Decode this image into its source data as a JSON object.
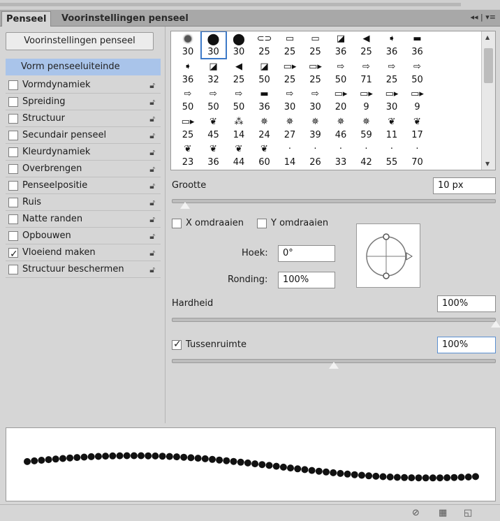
{
  "tabs": {
    "active": "Penseel",
    "inactive": "Voorinstellingen penseel",
    "menu": "◂◂ | ▾≡"
  },
  "left": {
    "preset_button": "Voorinstellingen penseel",
    "tip_label": "Vorm penseeluiteinde",
    "options": [
      {
        "label": "Vormdynamiek",
        "checked": false
      },
      {
        "label": "Spreiding",
        "checked": false
      },
      {
        "label": "Structuur",
        "checked": false
      },
      {
        "label": "Secundair penseel",
        "checked": false
      },
      {
        "label": "Kleurdynamiek",
        "checked": false
      },
      {
        "label": "Overbrengen",
        "checked": false
      },
      {
        "label": "Penseelpositie",
        "checked": false
      },
      {
        "label": "Ruis",
        "checked": false
      },
      {
        "label": "Natte randen",
        "checked": false
      },
      {
        "label": "Opbouwen",
        "checked": false
      },
      {
        "label": "Vloeiend maken",
        "checked": true
      },
      {
        "label": "Structuur beschermen",
        "checked": false
      }
    ]
  },
  "brushes": {
    "rows": [
      [
        {
          "icon": "soft-round",
          "size": "30"
        },
        {
          "icon": "hard-round",
          "size": "30",
          "selected": true
        },
        {
          "icon": "hard-round",
          "size": "30"
        },
        {
          "icon": "tip-a",
          "size": "25"
        },
        {
          "icon": "tip-b",
          "size": "25"
        },
        {
          "icon": "tip-b",
          "size": "25"
        },
        {
          "icon": "tip-c",
          "size": "36"
        },
        {
          "icon": "tip-d",
          "size": "25"
        },
        {
          "icon": "tip-e",
          "size": "36"
        },
        {
          "icon": "tip-f",
          "size": "36"
        }
      ],
      [
        {
          "icon": "tip-e",
          "size": "36"
        },
        {
          "icon": "tip-c",
          "size": "32"
        },
        {
          "icon": "tip-d",
          "size": "25"
        },
        {
          "icon": "tip-c",
          "size": "50"
        },
        {
          "icon": "tip-g",
          "size": "25"
        },
        {
          "icon": "tip-g",
          "size": "25"
        },
        {
          "icon": "tip-h",
          "size": "50"
        },
        {
          "icon": "tip-h",
          "size": "71"
        },
        {
          "icon": "tip-h",
          "size": "25"
        },
        {
          "icon": "tip-h",
          "size": "50"
        }
      ],
      [
        {
          "icon": "tip-h",
          "size": "50"
        },
        {
          "icon": "tip-h",
          "size": "50"
        },
        {
          "icon": "tip-h",
          "size": "50"
        },
        {
          "icon": "tip-f",
          "size": "36"
        },
        {
          "icon": "tip-h",
          "size": "30"
        },
        {
          "icon": "tip-h",
          "size": "30"
        },
        {
          "icon": "tip-g",
          "size": "20"
        },
        {
          "icon": "tip-g",
          "size": "9"
        },
        {
          "icon": "tip-g",
          "size": "30"
        },
        {
          "icon": "tip-g",
          "size": "9"
        }
      ],
      [
        {
          "icon": "tip-g",
          "size": "25"
        },
        {
          "icon": "leaf",
          "size": "45"
        },
        {
          "icon": "grass",
          "size": "14"
        },
        {
          "icon": "scatter",
          "size": "24"
        },
        {
          "icon": "scatter",
          "size": "27"
        },
        {
          "icon": "scatter",
          "size": "39"
        },
        {
          "icon": "scatter",
          "size": "46"
        },
        {
          "icon": "scatter",
          "size": "59"
        },
        {
          "icon": "leaf",
          "size": "11"
        },
        {
          "icon": "leaf",
          "size": "17"
        }
      ],
      [
        {
          "icon": "leaf",
          "size": "23"
        },
        {
          "icon": "leaf",
          "size": "36"
        },
        {
          "icon": "leaf",
          "size": "44"
        },
        {
          "icon": "leaf",
          "size": "60"
        },
        {
          "icon": "dot",
          "size": "14"
        },
        {
          "icon": "dot",
          "size": "26"
        },
        {
          "icon": "dot",
          "size": "33"
        },
        {
          "icon": "dot",
          "size": "42"
        },
        {
          "icon": "dot",
          "size": "55"
        },
        {
          "icon": "dot",
          "size": "70"
        }
      ]
    ]
  },
  "controls": {
    "size_label": "Grootte",
    "size_value": "10 px",
    "size_level": 0.04,
    "flip_x": "X omdraaien",
    "flip_y": "Y omdraaien",
    "angle_label": "Hoek:",
    "angle_value": "0°",
    "roundness_label": "Ronding:",
    "roundness_value": "100%",
    "hardness_label": "Hardheid",
    "hardness_value": "100%",
    "hardness_level": 1.0,
    "spacing_label": "Tussenruimte",
    "spacing_value": "100%",
    "spacing_checked": true,
    "spacing_level": 0.5
  },
  "bottom_icons": [
    "eye-icon",
    "grid-icon",
    "new-icon"
  ]
}
